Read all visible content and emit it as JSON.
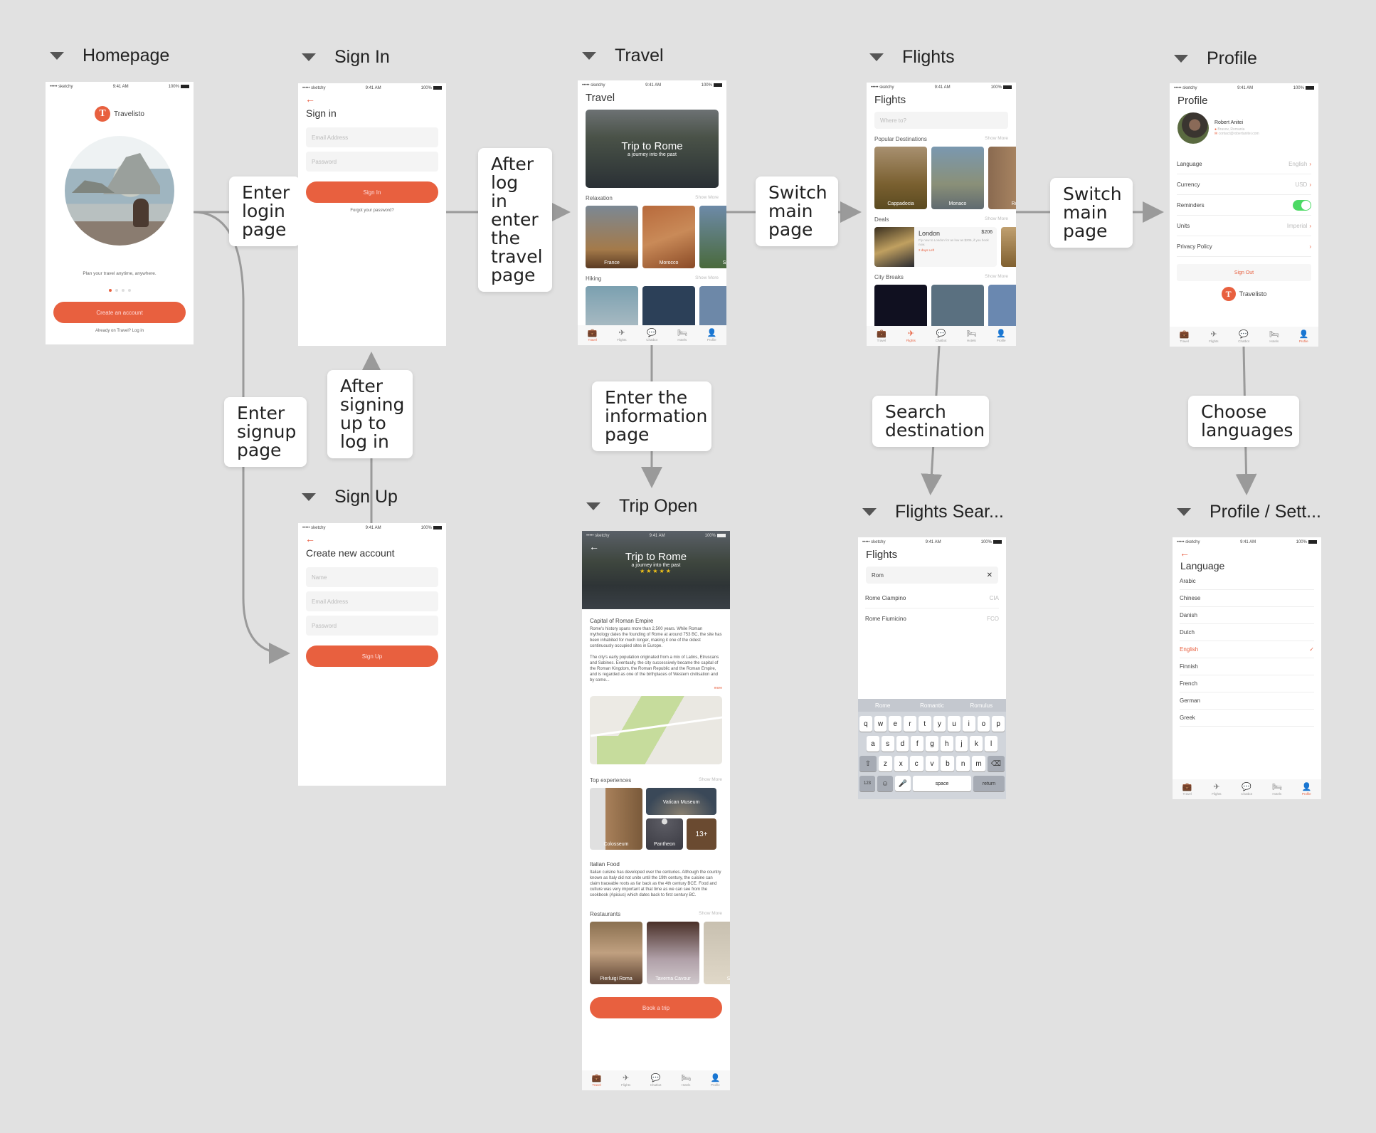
{
  "frames": {
    "homepage": "Homepage",
    "sign_in": "Sign In",
    "travel": "Travel",
    "flights": "Flights",
    "profile": "Profile",
    "sign_up": "Sign Up",
    "trip_open": "Trip Open",
    "flights_search": "Flights Sear...",
    "profile_settings": "Profile / Sett..."
  },
  "flow_labels": {
    "enter_login": "Enter login page",
    "after_login": "After log in enter the travel page",
    "switch_main_1": "Switch main page",
    "switch_main_2": "Switch main page",
    "enter_signup": "Enter signup page",
    "after_signup": "After signing up to log in",
    "enter_info": "Enter the information page",
    "search_destination": "Search destination",
    "choose_languages": "Choose languages"
  },
  "status_bar": {
    "carrier": "••••• sketchy",
    "time": "9:41 AM",
    "battery": "100%"
  },
  "brand": {
    "name": "Travelisto",
    "logo_letter": "T",
    "accent": "#e8603f"
  },
  "tabbar": [
    {
      "label": "Travel",
      "icon": "suitcase-icon",
      "glyph": "💼"
    },
    {
      "label": "Flights",
      "icon": "airplane-icon",
      "glyph": "✈"
    },
    {
      "label": "Chatbot",
      "icon": "chat-icon",
      "glyph": "💬"
    },
    {
      "label": "Hotels",
      "icon": "bed-icon",
      "glyph": "🛏"
    },
    {
      "label": "Profile",
      "icon": "person-icon",
      "glyph": "👤"
    }
  ],
  "homepage": {
    "tagline": "Plan your travel anytime, anywhere.",
    "create_account": "Create an account",
    "login_link": "Already on Travel? Log in",
    "carousel_pages": 4,
    "carousel_active": 1
  },
  "sign_in": {
    "title": "Sign in",
    "email_placeholder": "Email Address",
    "password_placeholder": "Password",
    "submit": "Sign In",
    "forgot": "Forgot your password?"
  },
  "sign_up": {
    "title": "Create new account",
    "name_placeholder": "Name",
    "email_placeholder": "Email Address",
    "password_placeholder": "Password",
    "submit": "Sign Up"
  },
  "travel": {
    "title": "Travel",
    "hero_title": "Trip to Rome",
    "hero_subtitle": "a journey into the past",
    "sections": [
      {
        "title": "Relaxation",
        "more": "Show More",
        "cards": [
          "France",
          "Morocco",
          "Sp"
        ]
      },
      {
        "title": "Hiking",
        "more": "Show More",
        "cards": [
          "",
          "",
          ""
        ]
      }
    ]
  },
  "flights": {
    "title": "Flights",
    "search_placeholder": "Where to?",
    "popular": {
      "title": "Popular Destinations",
      "more": "Show More",
      "cards": [
        "Cappadocia",
        "Monaco",
        "Ro"
      ]
    },
    "deals": {
      "title": "Deals",
      "more": "Show More",
      "city": "London",
      "price": "$206",
      "desc": "Fly now to London for as low as $206, if you book now.",
      "left": "2 days Left"
    },
    "city_breaks": {
      "title": "City Breaks",
      "more": "Show More"
    }
  },
  "profile": {
    "title": "Profile",
    "name": "Robert Anitei",
    "location": "Brasov, Romania",
    "email": "contact@robertanitei.com",
    "rows": [
      {
        "label": "Language",
        "value": "English"
      },
      {
        "label": "Currency",
        "value": "USD"
      },
      {
        "label": "Reminders",
        "value": ""
      },
      {
        "label": "Units",
        "value": "Imperial"
      },
      {
        "label": "Privacy Policy",
        "value": ""
      }
    ],
    "reminders_on": true,
    "sign_out": "Sign Out"
  },
  "trip_open": {
    "hero_title": "Trip to Rome",
    "hero_subtitle": "a journey into the past",
    "rating": 5,
    "section1_title": "Capital of Roman Empire",
    "section1_p1": "Rome's history spans more than 2,500 years. While Roman mythology dates the founding of Rome at around 753 BC, the site has been inhabited for much longer, making it one of the oldest continuously occupied sites in Europe.",
    "section1_p2": "The city's early population originated from a mix of Latins, Etruscans and Sabines. Eventually, the city successively became the capital of the Roman Kingdom, the Roman Republic and the Roman Empire, and is regarded as one of the birthplaces of Western civilisation and by some...",
    "more_link": "more",
    "experiences": {
      "title": "Top experiences",
      "more": "Show More",
      "items": [
        "Colosseum",
        "Vatican Museum",
        "Pantheon",
        "13+"
      ]
    },
    "food_title": "Italian Food",
    "food_text": "Italian cuisine has developed over the centuries. Although the country known as Italy did not unite until the 19th century, the cuisine can claim traceable roots as far back as the 4th century BCE. Food and culture was very important at that time as we can see from the cookbook (Apicius) which dates back to first century BC.",
    "restaurants": {
      "title": "Restaurants",
      "more": "Show More",
      "items": [
        "Pierluigi Roma",
        "Taverna Cavour",
        "Sa"
      ]
    },
    "book": "Book a trip"
  },
  "flights_search": {
    "title": "Flights",
    "query": "Rom",
    "results": [
      {
        "name": "Rome Ciampino",
        "code": "CIA"
      },
      {
        "name": "Rome Fiumicino",
        "code": "FCO"
      }
    ],
    "suggestions": [
      "Rome",
      "Romantic",
      "Romulus"
    ],
    "keys_row1": [
      "q",
      "w",
      "e",
      "r",
      "t",
      "y",
      "u",
      "i",
      "o",
      "p"
    ],
    "keys_row2": [
      "a",
      "s",
      "d",
      "f",
      "g",
      "h",
      "j",
      "k",
      "l"
    ],
    "keys_row3": [
      "z",
      "x",
      "c",
      "v",
      "b",
      "n",
      "m"
    ],
    "key_123": "123",
    "key_space": "space",
    "key_return": "return"
  },
  "profile_settings": {
    "title": "Language",
    "languages": [
      "Arabic",
      "Chinese",
      "Danish",
      "Dutch",
      "English",
      "Finnish",
      "French",
      "German",
      "Greek"
    ],
    "selected": "English"
  }
}
